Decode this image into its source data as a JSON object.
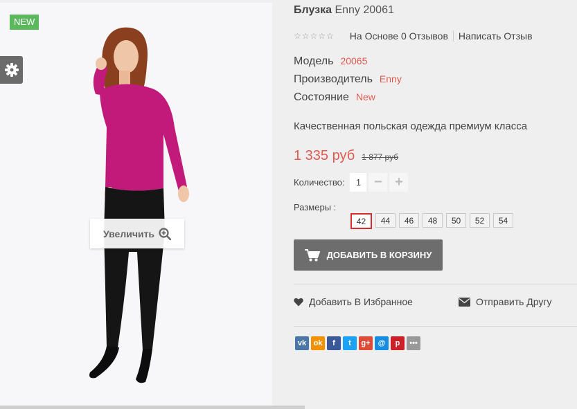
{
  "badge": "NEW",
  "zoom_label": "Увеличить",
  "product": {
    "name": "Блузка",
    "code": "Enny 20061",
    "stars": "☆☆☆☆☆",
    "reviews": "На Основе 0 Отзывов",
    "write_review": "Написать Отзыв",
    "specs": {
      "model_label": "Модель",
      "model_value": "20065",
      "maker_label": "Производитель",
      "maker_value": "Enny",
      "state_label": "Состояние",
      "state_value": "New"
    },
    "description": "Качественная польская одежда премиум класса",
    "price": "1 335 руб",
    "old_price": "1 877 руб"
  },
  "quantity": {
    "label": "Количество:",
    "value": "1",
    "minus": "−",
    "plus": "+"
  },
  "sizes": {
    "label": "Размеры :",
    "items": [
      "42",
      "44",
      "46",
      "48",
      "50",
      "52",
      "54"
    ],
    "selected": "42"
  },
  "cart_button": "ДОБАВИТЬ В КОРЗИНУ",
  "actions": {
    "wishlist": "Добавить В Избранное",
    "send_friend": "Отправить Другу"
  },
  "social": [
    {
      "icon": "vk-icon",
      "glyph": "vk",
      "color": "#4a76a8"
    },
    {
      "icon": "odnoklassniki-icon",
      "glyph": "ok",
      "color": "#f39200"
    },
    {
      "icon": "facebook-icon",
      "glyph": "f",
      "color": "#3b5998"
    },
    {
      "icon": "twitter-icon",
      "glyph": "t",
      "color": "#1da1f2"
    },
    {
      "icon": "google-plus-icon",
      "glyph": "g+",
      "color": "#dd4b39"
    },
    {
      "icon": "mailru-icon",
      "glyph": "@",
      "color": "#168de2"
    },
    {
      "icon": "pinterest-icon",
      "glyph": "p",
      "color": "#cb2027"
    },
    {
      "icon": "more-share-icon",
      "glyph": "•••",
      "color": "#999999"
    }
  ],
  "colors": {
    "accent": "#e05a50",
    "badge": "#5cb85c",
    "button": "#6d6d6d",
    "size_active": "#d52c2c"
  }
}
